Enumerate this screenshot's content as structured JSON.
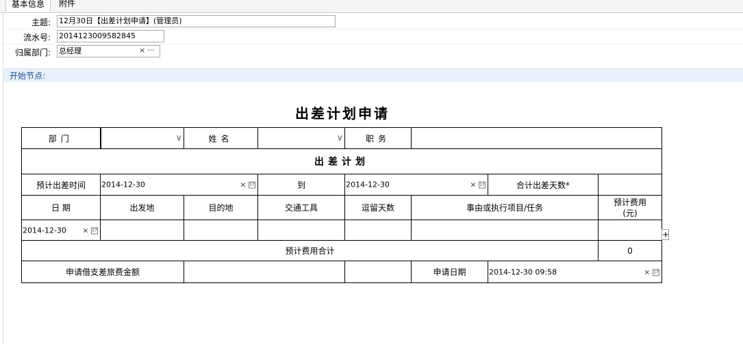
{
  "tabs": [
    "基本信息",
    "附件"
  ],
  "fields": {
    "subject_label": "主题:",
    "subject_value": "12月30日【出差计划申请】(管理员)",
    "serial_label": "流水号:",
    "serial_value": "2014123009582845",
    "dept_label": "归属部门:",
    "dept_value": "总经理"
  },
  "node_label": "开始节点:",
  "form": {
    "title": "出差计划申请",
    "dept": "部门",
    "name": "姓名",
    "position": "职务",
    "plan_title": "出差计划",
    "est_time": "预计出差时间",
    "start_date": "2014-12-30",
    "to": "到",
    "end_date": "2014-12-30",
    "total_days": "合计出差天数*",
    "col_date": "日 期",
    "col_from": "出发地",
    "col_dest": "目的地",
    "col_transport": "交通工具",
    "col_stay": "逗留天数",
    "col_reason": "事由或执行项目/任务",
    "col_cost": "预计费用\n(元)",
    "row_date": "2014-12-30",
    "cost_total_label": "预计费用合计",
    "cost_total_value": "0",
    "loan_label": "申请借支差旅费金额",
    "apply_date_label": "申请日期",
    "apply_date_value": "2014-12-30 09:58"
  },
  "icons": {
    "clear": "×",
    "more": "···",
    "calendar": "calendar-icon",
    "dropdown": "chevron-down-icon",
    "add": "+"
  }
}
